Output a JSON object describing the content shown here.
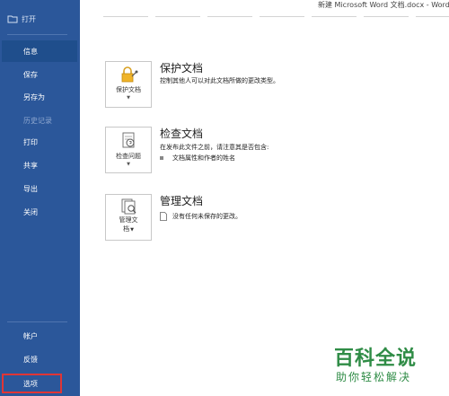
{
  "window": {
    "title": "新建 Microsoft Word 文档.docx  -  Word"
  },
  "sidebar": {
    "open_label": "打开",
    "items": [
      {
        "label": "信息",
        "state": "active"
      },
      {
        "label": "保存",
        "state": "normal"
      },
      {
        "label": "另存为",
        "state": "normal"
      },
      {
        "label": "历史记录",
        "state": "disabled"
      },
      {
        "label": "打印",
        "state": "normal"
      },
      {
        "label": "共享",
        "state": "normal"
      },
      {
        "label": "导出",
        "state": "normal"
      },
      {
        "label": "关闭",
        "state": "normal"
      }
    ],
    "bottom_items": [
      {
        "label": "帐户"
      },
      {
        "label": "反馈"
      },
      {
        "label": "选项",
        "highlighted": true
      }
    ]
  },
  "main": {
    "protect": {
      "tile_label": "保护文档",
      "title": "保护文档",
      "desc": "控制其他人可以对此文档所做的更改类型。",
      "icon": "lock-icon"
    },
    "inspect": {
      "tile_label": "检查问题",
      "title": "检查文档",
      "desc": "在发布此文件之前，请注意其是否包含:",
      "bullet": "文档属性和作者的姓名",
      "icon": "inspect-icon"
    },
    "manage": {
      "tile_label_1": "管理文",
      "tile_label_2": "档",
      "title": "管理文档",
      "desc": "没有任何未保存的更改。",
      "icon": "manage-icon"
    }
  },
  "watermark": {
    "big": "百科全说",
    "small": "助你轻松解决"
  },
  "colors": {
    "sidebar": "#2b579a",
    "active_item": "#1f4e8c",
    "highlight_border": "#e03535",
    "watermark": "#2f8c46"
  }
}
